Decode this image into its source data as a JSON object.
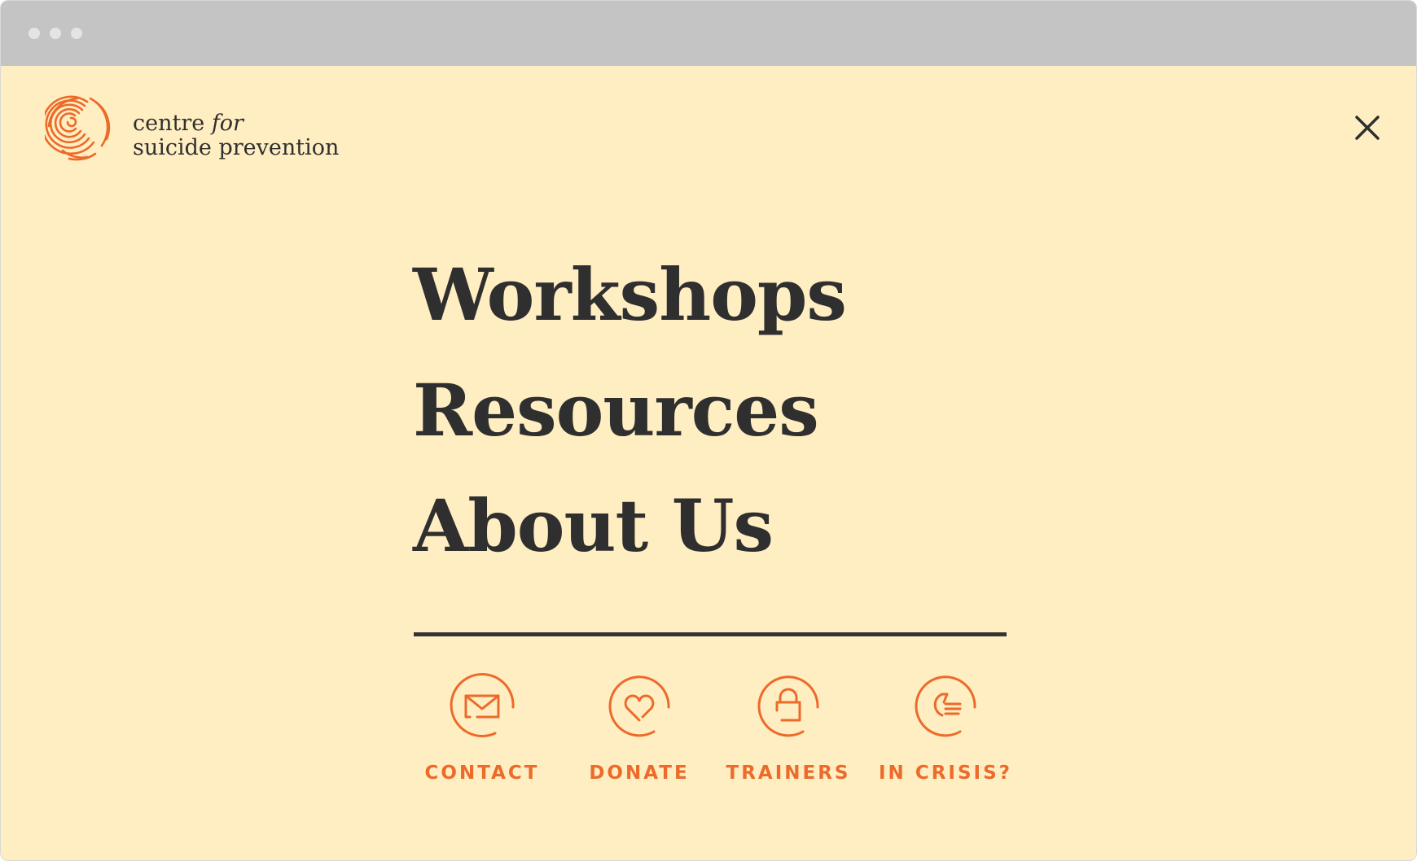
{
  "brand": {
    "line1_regular": "centre ",
    "line1_italic": "for",
    "line2": "suicide prevention",
    "accent_color": "#ec6a2a"
  },
  "header": {
    "close_icon": "close-icon"
  },
  "menu": {
    "items": [
      {
        "label": "Workshops"
      },
      {
        "label": "Resources"
      },
      {
        "label": "About Us"
      }
    ]
  },
  "quick_links": [
    {
      "label": "CONTACT",
      "icon": "mail-icon"
    },
    {
      "label": "DONATE",
      "icon": "heart-icon"
    },
    {
      "label": "TRAINERS",
      "icon": "lock-icon"
    },
    {
      "label": "IN CRISIS?",
      "icon": "hand-icon"
    }
  ],
  "colors": {
    "background": "#ffeec2",
    "text": "#2f2f2f",
    "titlebar": "#c4c4c4"
  }
}
